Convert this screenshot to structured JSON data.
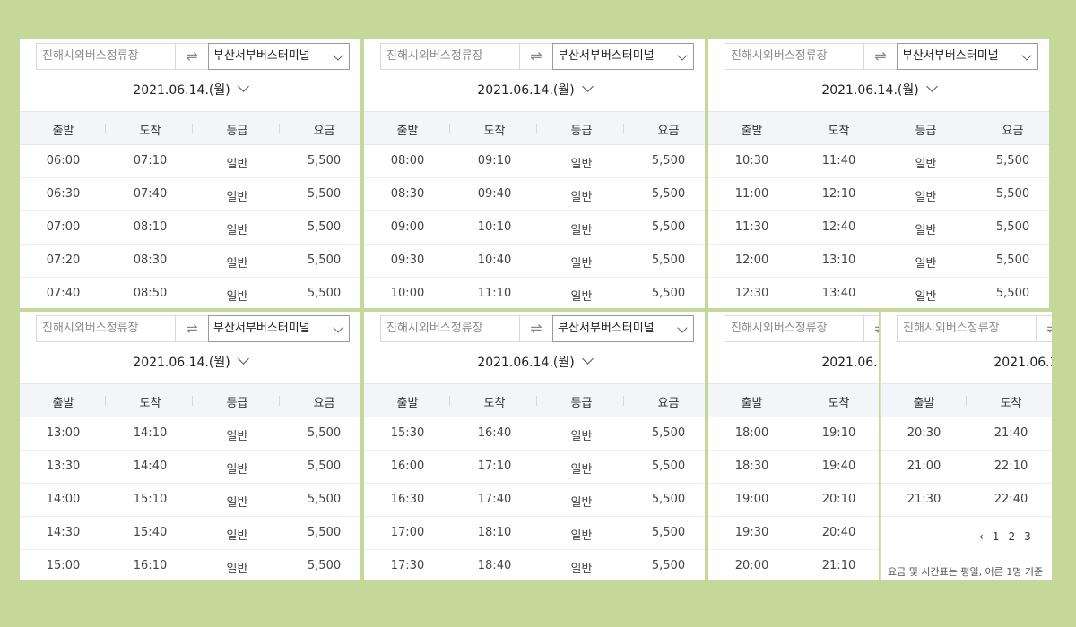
{
  "route": {
    "from_placeholder": "진해시외버스정류장",
    "to": "부산서부버스터미널",
    "swap_icon": "⇌"
  },
  "date": "2021.06.14.(월)",
  "columns": [
    "출발",
    "도착",
    "등급",
    "요금"
  ],
  "panels": [
    {
      "rows": [
        [
          "06:00",
          "07:10",
          "일반",
          "5,500"
        ],
        [
          "06:30",
          "07:40",
          "일반",
          "5,500"
        ],
        [
          "07:00",
          "08:10",
          "일반",
          "5,500"
        ],
        [
          "07:20",
          "08:30",
          "일반",
          "5,500"
        ],
        [
          "07:40",
          "08:50",
          "일반",
          "5,500"
        ]
      ]
    },
    {
      "rows": [
        [
          "08:00",
          "09:10",
          "일반",
          "5,500"
        ],
        [
          "08:30",
          "09:40",
          "일반",
          "5,500"
        ],
        [
          "09:00",
          "10:10",
          "일반",
          "5,500"
        ],
        [
          "09:30",
          "10:40",
          "일반",
          "5,500"
        ],
        [
          "10:00",
          "11:10",
          "일반",
          "5,500"
        ]
      ]
    },
    {
      "rows": [
        [
          "10:30",
          "11:40",
          "일반",
          "5,500"
        ],
        [
          "11:00",
          "12:10",
          "일반",
          "5,500"
        ],
        [
          "11:30",
          "12:40",
          "일반",
          "5,500"
        ],
        [
          "12:00",
          "13:10",
          "일반",
          "5,500"
        ],
        [
          "12:30",
          "13:40",
          "일반",
          "5,500"
        ]
      ]
    },
    {
      "rows": [
        [
          "13:00",
          "14:10",
          "일반",
          "5,500"
        ],
        [
          "13:30",
          "14:40",
          "일반",
          "5,500"
        ],
        [
          "14:00",
          "15:10",
          "일반",
          "5,500"
        ],
        [
          "14:30",
          "15:40",
          "일반",
          "5,500"
        ],
        [
          "15:00",
          "16:10",
          "일반",
          "5,500"
        ]
      ]
    },
    {
      "rows": [
        [
          "15:30",
          "16:40",
          "일반",
          "5,500"
        ],
        [
          "16:00",
          "17:10",
          "일반",
          "5,500"
        ],
        [
          "16:30",
          "17:40",
          "일반",
          "5,500"
        ],
        [
          "17:00",
          "18:10",
          "일반",
          "5,500"
        ],
        [
          "17:30",
          "18:40",
          "일반",
          "5,500"
        ]
      ]
    },
    {
      "rows": [
        [
          "18:00",
          "19:10",
          "",
          ""
        ],
        [
          "18:30",
          "19:40",
          "",
          ""
        ],
        [
          "19:00",
          "20:10",
          "",
          ""
        ],
        [
          "19:30",
          "20:40",
          "",
          ""
        ],
        [
          "20:00",
          "21:10",
          "",
          ""
        ]
      ]
    },
    {
      "rows": [
        [
          "20:30",
          "21:40",
          "",
          ""
        ],
        [
          "21:00",
          "22:10",
          "",
          ""
        ],
        [
          "21:30",
          "22:40",
          "",
          ""
        ]
      ],
      "pagination": {
        "prev": "‹",
        "pages": [
          "1",
          "2",
          "3"
        ]
      },
      "footnote": "요금 및 시간표는 평일, 어른 1명 기준"
    }
  ]
}
